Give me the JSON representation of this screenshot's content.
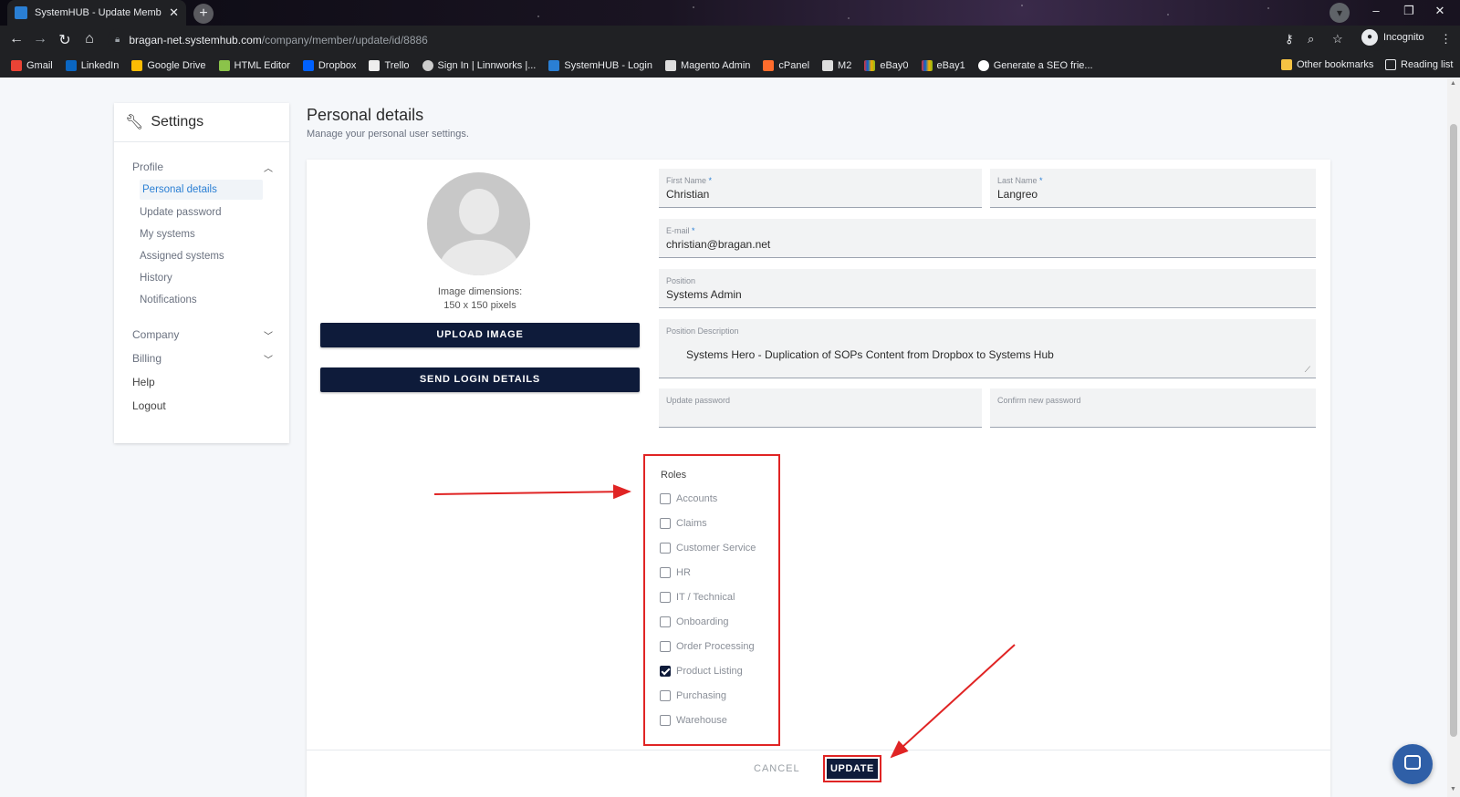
{
  "browser": {
    "tab_title": "SystemHUB - Update Member",
    "url_host": "bragan-net.systemhub.com",
    "url_path": "/company/member/update/id/8886",
    "incognito_label": "Incognito",
    "bookmarks": [
      "Gmail",
      "LinkedIn",
      "Google Drive",
      "HTML Editor",
      "Dropbox",
      "Trello",
      "Sign In | Linnworks |...",
      "SystemHUB - Login",
      "Magento Admin",
      "cPanel",
      "M2",
      "eBay0",
      "eBay1",
      "Generate a SEO frie..."
    ],
    "other_bookmarks": "Other bookmarks",
    "reading_list": "Reading list"
  },
  "sidebar": {
    "title": "Settings",
    "profile_label": "Profile",
    "profile_items": [
      "Personal details",
      "Update password",
      "My systems",
      "Assigned systems",
      "History",
      "Notifications"
    ],
    "company_label": "Company",
    "billing_label": "Billing",
    "help_label": "Help",
    "logout_label": "Logout"
  },
  "page": {
    "title": "Personal details",
    "subtitle": "Manage your personal user settings."
  },
  "form": {
    "image_dims_line1": "Image dimensions:",
    "image_dims_line2": "150 x 150 pixels",
    "upload_label": "UPLOAD IMAGE",
    "send_login_label": "SEND LOGIN DETAILS",
    "first_name_label": "First Name",
    "first_name_value": "Christian",
    "last_name_label": "Last Name",
    "last_name_value": "Langreo",
    "email_label": "E-mail",
    "email_value": "christian@bragan.net",
    "position_label": "Position",
    "position_value": "Systems Admin",
    "position_desc_label": "Position Description",
    "position_desc_value": "Systems Hero - Duplication of SOPs Content from Dropbox to Systems Hub",
    "update_password_label": "Update password",
    "confirm_password_label": "Confirm new password",
    "required_mark": "*"
  },
  "roles": {
    "title": "Roles",
    "items": [
      {
        "label": "Accounts",
        "checked": false
      },
      {
        "label": "Claims",
        "checked": false
      },
      {
        "label": "Customer Service",
        "checked": false
      },
      {
        "label": "HR",
        "checked": false
      },
      {
        "label": "IT / Technical",
        "checked": false
      },
      {
        "label": "Onboarding",
        "checked": false
      },
      {
        "label": "Order Processing",
        "checked": false
      },
      {
        "label": "Product Listing",
        "checked": true
      },
      {
        "label": "Purchasing",
        "checked": false
      },
      {
        "label": "Warehouse",
        "checked": false
      }
    ]
  },
  "actions": {
    "cancel_label": "CANCEL",
    "update_label": "UPDATE"
  },
  "colors": {
    "accent": "#2a7fd4",
    "button_dark": "#0e1b3a",
    "annotation_red": "#e02424"
  }
}
